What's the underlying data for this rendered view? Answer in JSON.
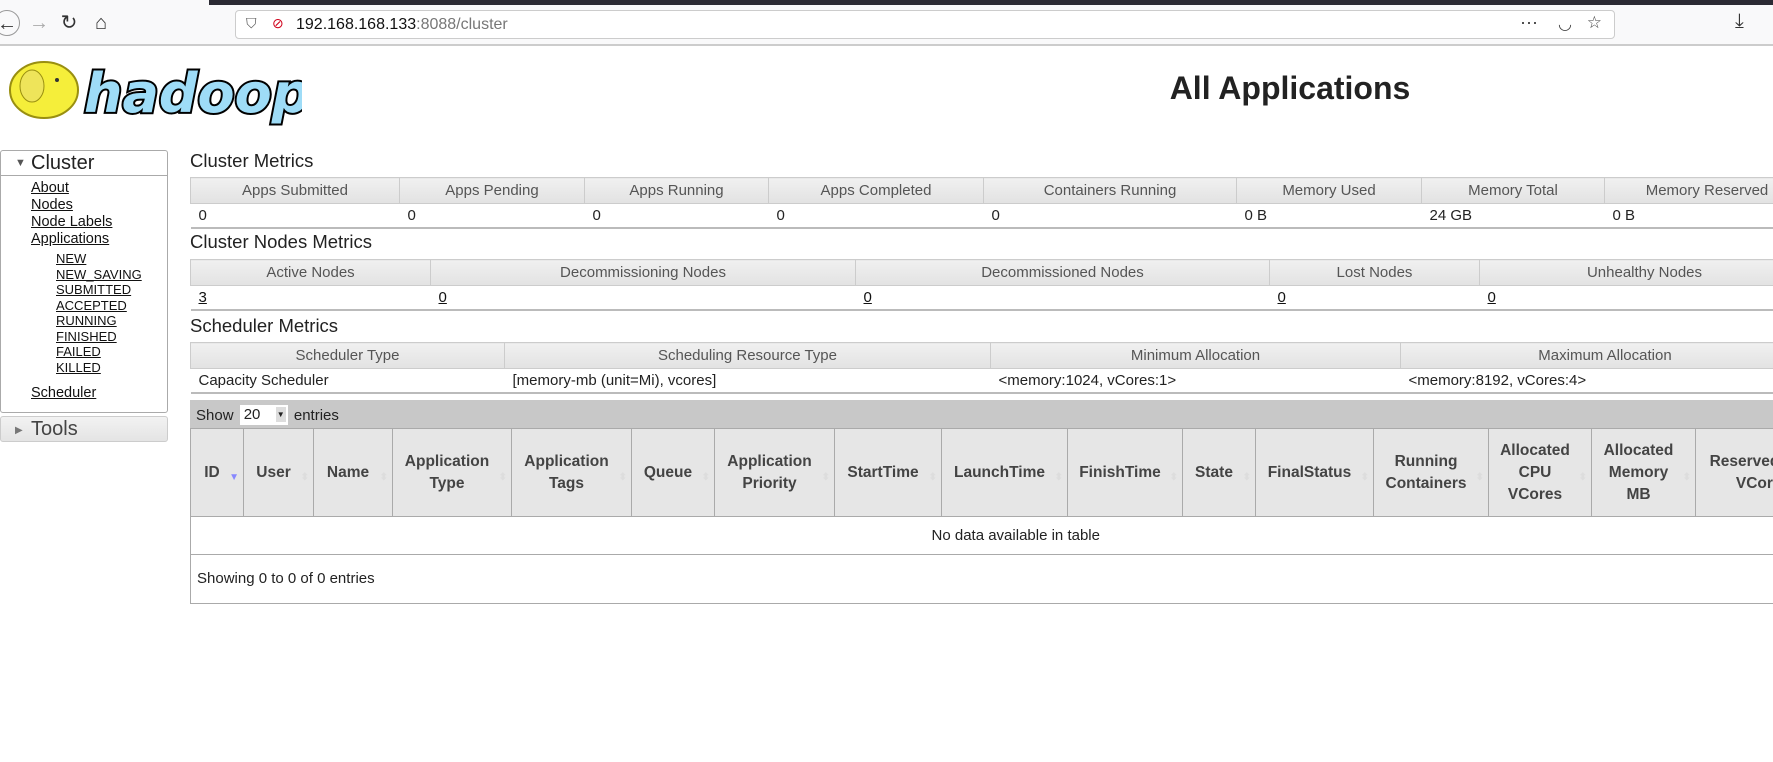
{
  "browser": {
    "url_host": "192.168.168.133",
    "url_rest": ":8088/cluster",
    "icons": [
      "back-icon",
      "forward-icon",
      "reload-icon",
      "home-icon",
      "shield-icon",
      "insecure-lock-icon",
      "more-icon",
      "pocket-icon",
      "star-icon",
      "download-icon"
    ]
  },
  "logo": {
    "text": "hadoop"
  },
  "page_title": "All Applications",
  "sidebar": {
    "cluster_label": "Cluster",
    "links": [
      "About",
      "Nodes",
      "Node Labels",
      "Applications"
    ],
    "states": [
      "NEW",
      "NEW_SAVING",
      "SUBMITTED",
      "ACCEPTED",
      "RUNNING",
      "FINISHED",
      "FAILED",
      "KILLED"
    ],
    "scheduler": "Scheduler",
    "tools_label": "Tools"
  },
  "cluster_metrics": {
    "title": "Cluster Metrics",
    "headers": [
      "Apps Submitted",
      "Apps Pending",
      "Apps Running",
      "Apps Completed",
      "Containers Running",
      "Memory Used",
      "Memory Total",
      "Memory Reserved"
    ],
    "values": [
      "0",
      "0",
      "0",
      "0",
      "0",
      "0 B",
      "24 GB",
      "0 B"
    ]
  },
  "node_metrics": {
    "title": "Cluster Nodes Metrics",
    "headers": [
      "Active Nodes",
      "Decommissioning Nodes",
      "Decommissioned Nodes",
      "Lost Nodes",
      "Unhealthy Nodes"
    ],
    "values": [
      "3",
      "0",
      "0",
      "0",
      "0"
    ]
  },
  "scheduler_metrics": {
    "title": "Scheduler Metrics",
    "headers": [
      "Scheduler Type",
      "Scheduling Resource Type",
      "Minimum Allocation",
      "Maximum Allocation"
    ],
    "values": [
      "Capacity Scheduler",
      "[memory-mb (unit=Mi), vcores]",
      "<memory:1024, vCores:1>",
      "<memory:8192, vCores:4>"
    ]
  },
  "apps_table": {
    "show_label": "Show",
    "page_size": "20",
    "entries_label": "entries",
    "columns": [
      "ID",
      "User",
      "Name",
      "Application Type",
      "Application Tags",
      "Queue",
      "Application Priority",
      "StartTime",
      "LaunchTime",
      "FinishTime",
      "State",
      "FinalStatus",
      "Running Containers",
      "Allocated CPU VCores",
      "Allocated Memory MB",
      "Reserved CPU VCores"
    ],
    "empty_message": "No data available in table",
    "info": "Showing 0 to 0 of 0 entries"
  }
}
